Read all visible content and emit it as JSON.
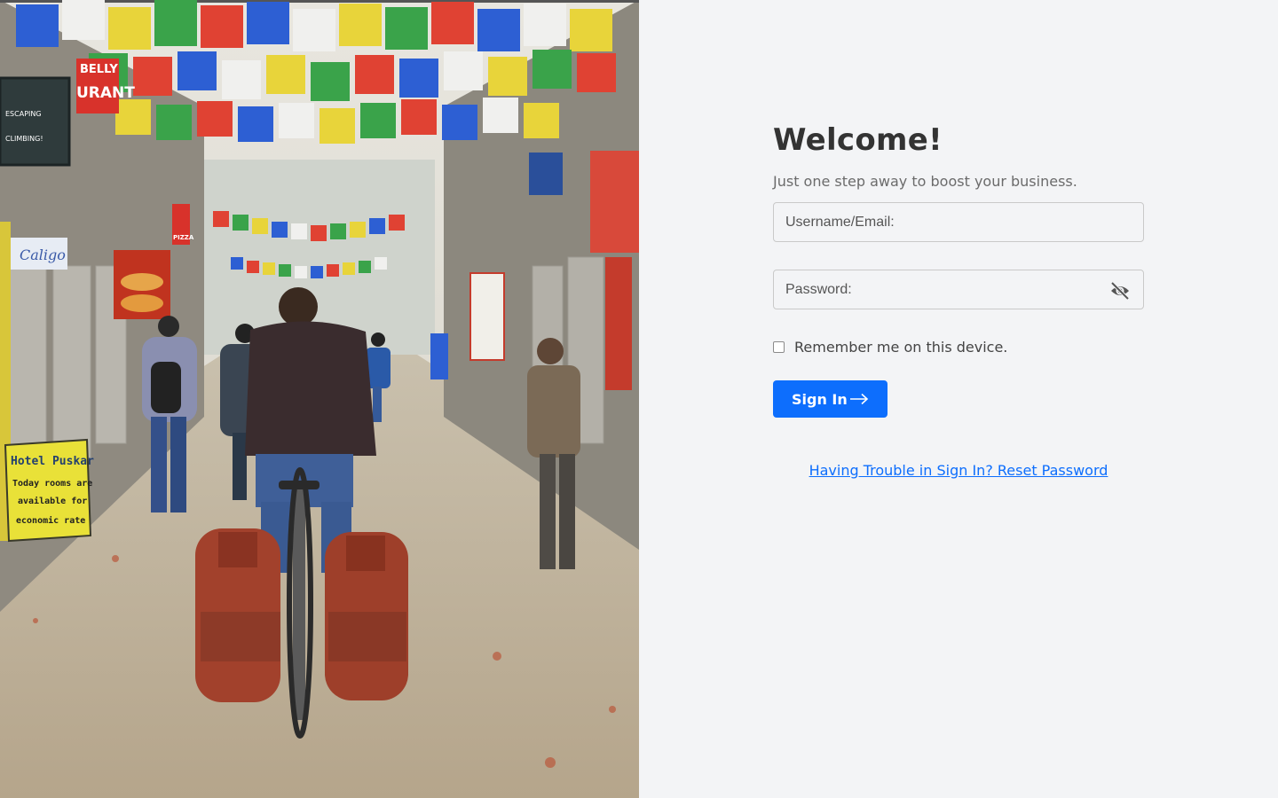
{
  "hero": {
    "signs": {
      "hotel_name": "Hotel Puskar",
      "hotel_line1": "Today rooms are",
      "hotel_line2": "available for",
      "hotel_line3": "economic rate",
      "caligo": "Caligo",
      "pizza": "PIZZA",
      "belly": "BELLY",
      "urant": "URANT",
      "escaping1": "ESCAPING",
      "escaping2": "CLIMBING!"
    }
  },
  "login": {
    "title": "Welcome!",
    "subtitle": "Just one step away to boost your business.",
    "username_placeholder": "Username/Email:",
    "username_value": "",
    "password_placeholder": "Password:",
    "password_value": "",
    "password_toggle_icon": "eye-slash-icon",
    "remember_label": "Remember me on this device.",
    "remember_checked": false,
    "signin_label": "Sign In",
    "signin_icon": "arrow-right-icon",
    "reset_link": "Having Trouble in Sign In? Reset Password"
  },
  "colors": {
    "background": "#f3f4f6",
    "primary": "#0d6efd",
    "title": "#333333",
    "muted": "#6b6b6b"
  }
}
